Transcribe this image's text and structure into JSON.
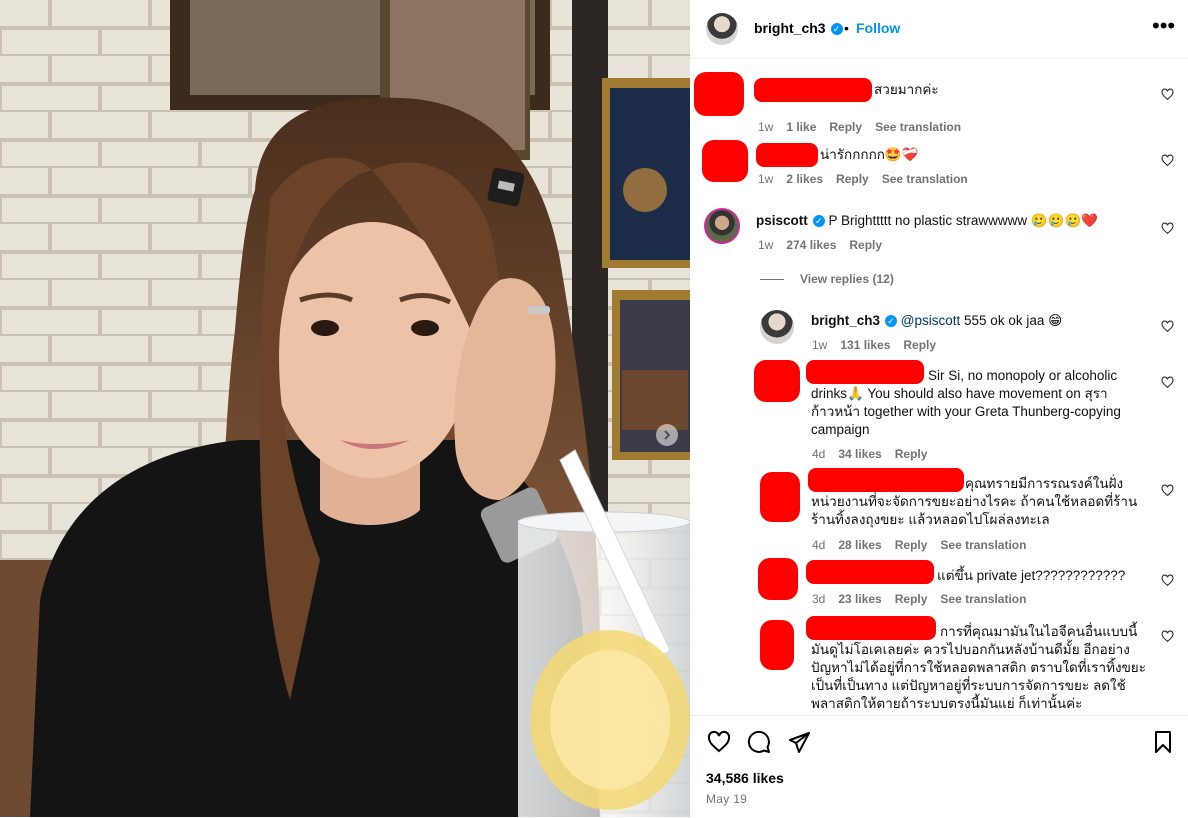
{
  "post": {
    "username": "bright_ch3",
    "follow_label": "Follow",
    "likes_text": "34,586 likes",
    "date": "May 19"
  },
  "comments": [
    {
      "text": "สวยมากค่ะ",
      "time": "1w",
      "likes": "1 like",
      "reply": "Reply",
      "translate": "See translation"
    },
    {
      "text": "น่ารักกกกก🤩❤️‍🩹",
      "time": "1w",
      "likes": "2 likes",
      "reply": "Reply",
      "translate": "See translation"
    },
    {
      "username": "psiscott",
      "text": "P Brighttttt no plastic strawwwww 🥲🥲🥲❤️",
      "time": "1w",
      "likes": "274 likes",
      "reply": "Reply"
    }
  ],
  "view_replies": "View replies (12)",
  "replies": [
    {
      "username": "bright_ch3",
      "mention": "@psiscott",
      "text": "555 ok ok jaa 😁",
      "time": "1w",
      "likes": "131 likes",
      "reply": "Reply"
    },
    {
      "text_line1": "Sir Si, no monopoly or alcoholic",
      "text_rest": "drinks🙏 You should also have movement on สุรา ก้าวหน้า together with your Greta Thunberg-copying campaign",
      "time": "4d",
      "likes": "34 likes",
      "reply": "Reply"
    },
    {
      "text_line1": "คุณทรายมีการรณรงค์ในฝั่ง",
      "text_rest": "หน่วยงานที่จะจัดการขยะอย่างไรคะ ถ้าคนใช้หลอดที่ร้าน ร้านทิ้งลงถุงขยะ แล้วหลอดไปโผล่ลงทะเล",
      "time": "4d",
      "likes": "28 likes",
      "reply": "Reply",
      "translate": "See translation"
    },
    {
      "text": "แต่ขึ้น private jet????????????",
      "time": "3d",
      "likes": "23 likes",
      "reply": "Reply",
      "translate": "See translation"
    },
    {
      "text_line1": "การที่คุณมามันในไอจีคนอื่นแบบนี้",
      "text_rest": "มันดูไม่โอเคเลยค่ะ ควรไปบอกกันหลังบ้านดีมั้ย อีกอย่าง ปัญหาไม่ได้อยู่ที่การใช้หลอดพลาสติก ตราบใดที่เราทิ้งขยะเป็นที่เป็นทาง แต่ปัญหาอยู่ที่ระบบการจัดการขยะ ลดใช้พลาสติกให้ตายถ้าระบบตรงนี้มันแย่ ก็เท่านั้นค่ะ"
    }
  ],
  "icons": {
    "like": "heart-icon",
    "comment": "comment-icon",
    "share": "share-icon",
    "save": "bookmark-icon",
    "more": "more-options-icon"
  },
  "colors": {
    "follow_blue": "#0095f6",
    "verified_blue": "#0095f6",
    "redaction_red": "#fe0000",
    "meta_gray": "#737373"
  }
}
